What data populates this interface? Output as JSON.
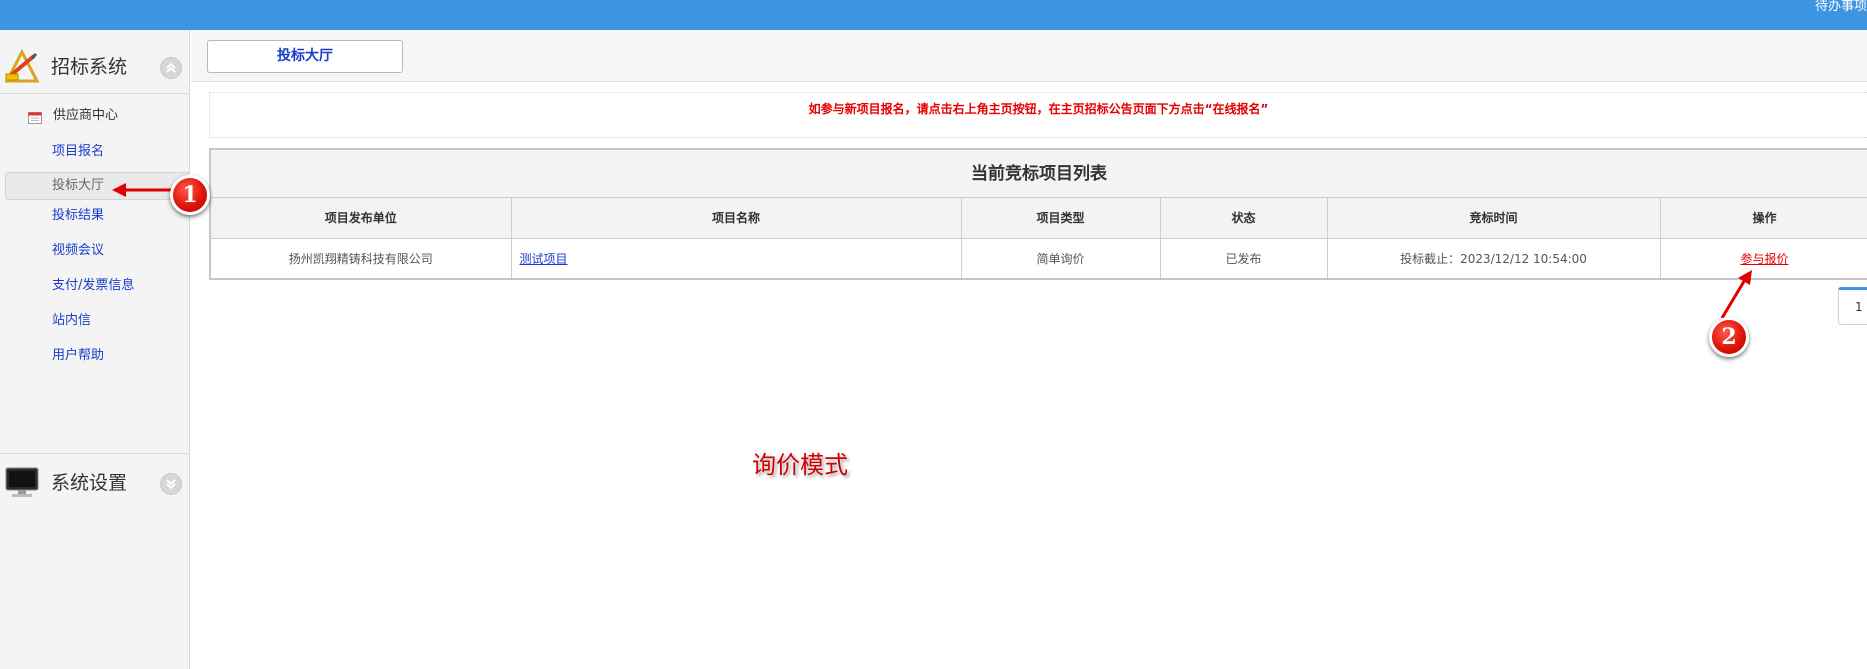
{
  "topbar": {
    "right_text": "待办事项"
  },
  "sidebar": {
    "section1": {
      "title": "招标系统",
      "icon": "pencil-ruler-icon"
    },
    "group": {
      "label": "供应商中心",
      "icon": "calendar-icon"
    },
    "items": [
      {
        "label": "项目报名"
      },
      {
        "label": "投标大厅",
        "active": true
      },
      {
        "label": "投标结果"
      },
      {
        "label": "视频会议"
      },
      {
        "label": "支付/发票信息"
      },
      {
        "label": "站内信"
      },
      {
        "label": "用户帮助"
      }
    ],
    "section2": {
      "title": "系统设置",
      "icon": "monitor-icon"
    }
  },
  "tabbar": {
    "active_tab": "投标大厅"
  },
  "notice": "如参与新项目报名，请点击右上角主页按钮，在主页招标公告页面下方点击“在线报名”",
  "grid": {
    "title": "当前竞标项目列表",
    "columns": [
      "项目发布单位",
      "项目名称",
      "项目类型",
      "状态",
      "竞标时间",
      "操作"
    ],
    "rows": [
      {
        "publisher": "扬州凯翔精铸科技有限公司",
        "name": "测试项目",
        "type": "简单询价",
        "status": "已发布",
        "time": "投标截止：2023/12/12 10:54:00",
        "action": "参与报价"
      }
    ]
  },
  "pager": {
    "page": "1"
  },
  "annotations": {
    "badge1": "1",
    "badge2": "2",
    "mode_label": "询价模式"
  },
  "colors": {
    "topbar": "#3d94e0",
    "link": "#1a3ccc",
    "alert": "#e60000"
  }
}
